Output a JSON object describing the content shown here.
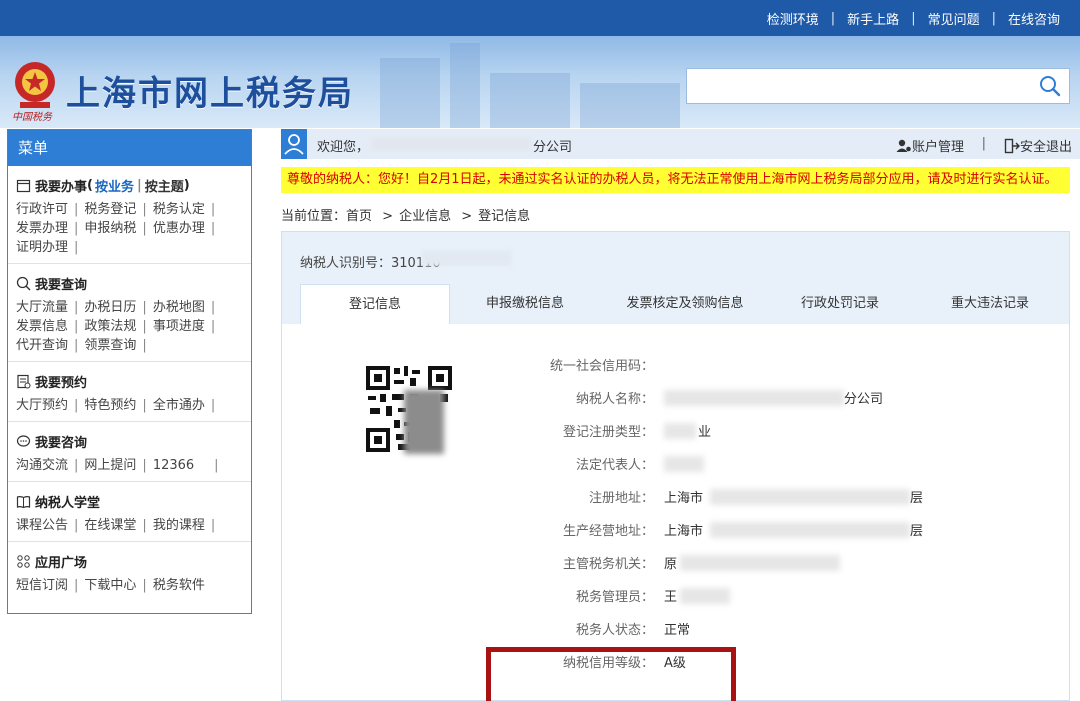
{
  "topbar": {
    "links": [
      "检测环境",
      "新手上路",
      "常见问题",
      "在线咨询"
    ]
  },
  "banner": {
    "title": "上海市网上税务局",
    "subtitle": "中国税务",
    "search_placeholder": ""
  },
  "sidebar": {
    "header": "菜单",
    "sections": [
      {
        "title": "我要办事",
        "tab_a": "按业务",
        "tab_b": "按主题",
        "icon": "calendar-icon",
        "lines": [
          [
            "行政许可",
            "税务登记",
            "税务认定"
          ],
          [
            "发票办理",
            "申报纳税",
            "优惠办理"
          ],
          [
            "证明办理"
          ]
        ]
      },
      {
        "title": "我要查询",
        "icon": "search-icon",
        "lines": [
          [
            "大厅流量",
            "办税日历",
            "办税地图"
          ],
          [
            "发票信息",
            "政策法规",
            "事项进度"
          ],
          [
            "代开查询",
            "领票查询"
          ]
        ]
      },
      {
        "title": "我要预约",
        "icon": "form-icon",
        "lines": [
          [
            "大厅预约",
            "特色预约",
            "全市通办"
          ]
        ]
      },
      {
        "title": "我要咨询",
        "icon": "chat-icon",
        "lines": [
          [
            "沟通交流",
            "网上提问",
            "12366"
          ]
        ]
      },
      {
        "title": "纳税人学堂",
        "icon": "book-icon",
        "lines": [
          [
            "课程公告",
            "在线课堂",
            "我的课程"
          ]
        ]
      },
      {
        "title": "应用广场",
        "icon": "apps-icon",
        "lines": [
          [
            "短信订阅",
            "下载中心",
            "税务软件"
          ]
        ]
      }
    ]
  },
  "welcome": {
    "greeting": "欢迎您，",
    "company_tail": "分公司",
    "account": "账户管理",
    "logout": "安全退出"
  },
  "notice": "尊敬的纳税人：您好！自2月1日起，未通过实名认证的办税人员，将无法正常使用上海市网上税务局部分应用，请及时进行实名认证。",
  "breadcrumb": {
    "prefix": "当前位置：",
    "items": [
      "首页",
      "企业信息",
      "登记信息"
    ]
  },
  "panel": {
    "taxid_label": "纳税人识别号：",
    "taxid_value": "310110",
    "tabs": [
      "登记信息",
      "申报缴税信息",
      "发票核定及领购信息",
      "行政处罚记录",
      "重大违法记录"
    ],
    "rows": [
      {
        "label": "统一社会信用码：",
        "value": ""
      },
      {
        "label": "纳税人名称：",
        "value": "",
        "tail": "分公司"
      },
      {
        "label": "登记注册类型：",
        "value": "",
        "tail": "业"
      },
      {
        "label": "法定代表人：",
        "value": ""
      },
      {
        "label": "注册地址：",
        "value": "上海市",
        "tail": "层"
      },
      {
        "label": "生产经营地址：",
        "value": "上海市",
        "tail": "层"
      },
      {
        "label": "主管税务机关：",
        "value": "原"
      },
      {
        "label": "税务管理员：",
        "value": "王"
      },
      {
        "label": "税务人状态：",
        "value": "正常"
      },
      {
        "label": "纳税信用等级：",
        "value": "A级"
      }
    ]
  },
  "colors": {
    "topbar": "#1f5aa8",
    "accent": "#2e7ed6",
    "notice_bg": "#ffff33",
    "notice_text": "#d80000",
    "highlight_border": "#a81212"
  }
}
